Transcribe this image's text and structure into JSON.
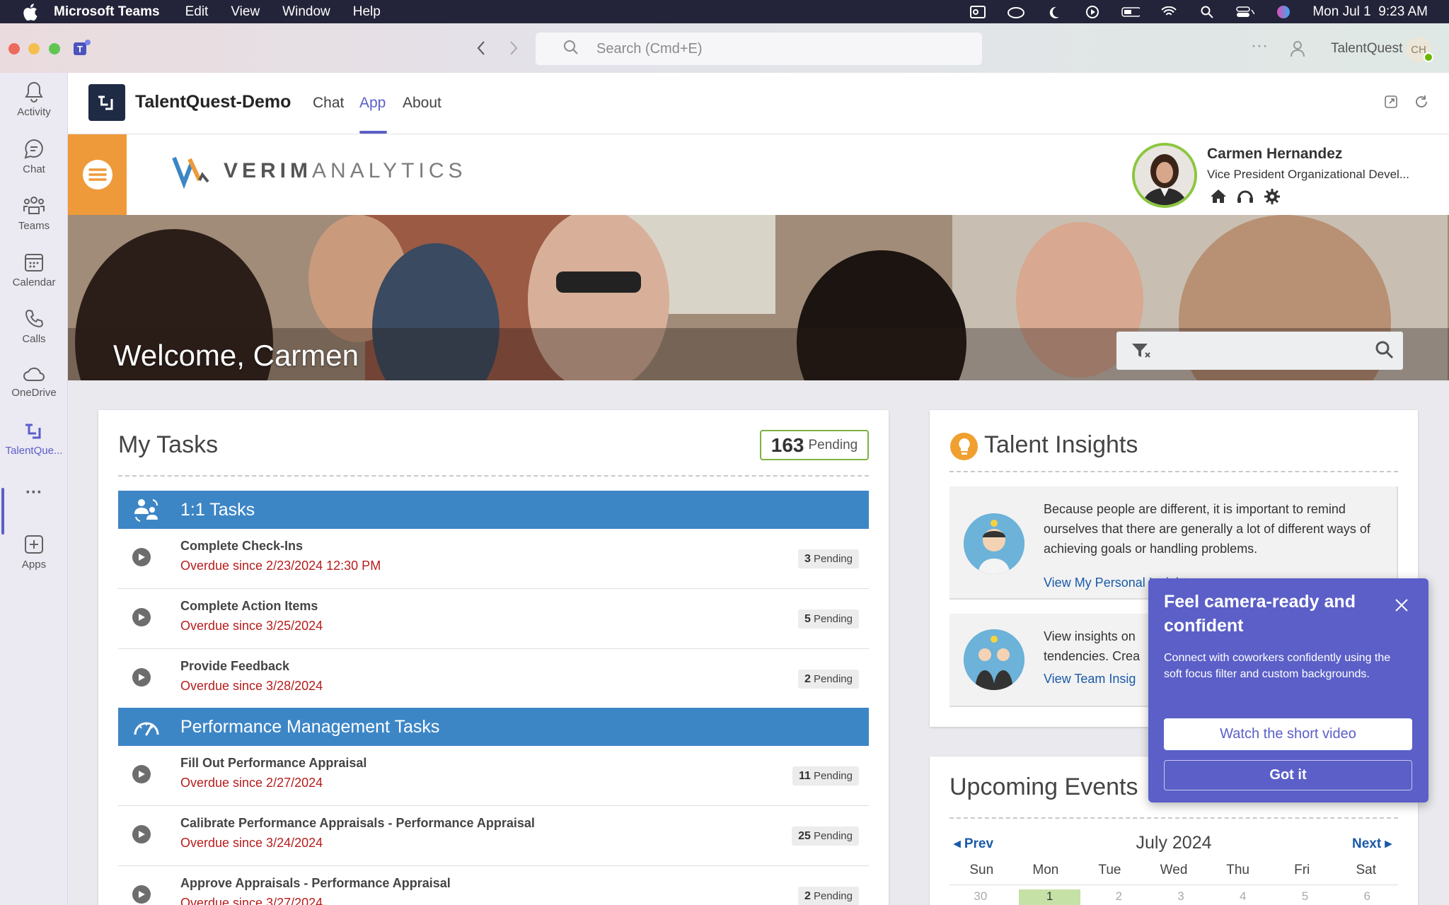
{
  "menubar": {
    "app": "Microsoft Teams",
    "items": [
      "Edit",
      "View",
      "Window",
      "Help"
    ],
    "datetime": "Mon Jul 1  9:23 AM"
  },
  "titlebar": {
    "search_placeholder": "Search (Cmd+E)",
    "more": "···",
    "org": "TalentQuest",
    "initials": "CH"
  },
  "rail": {
    "items": [
      {
        "label": "Activity",
        "icon": "bell-icon"
      },
      {
        "label": "Chat",
        "icon": "chat-icon"
      },
      {
        "label": "Teams",
        "icon": "teams-icon"
      },
      {
        "label": "Calendar",
        "icon": "calendar-icon"
      },
      {
        "label": "Calls",
        "icon": "phone-icon"
      },
      {
        "label": "OneDrive",
        "icon": "cloud-icon"
      },
      {
        "label": "TalentQue...",
        "icon": "talentquest-icon"
      },
      {
        "label": "···",
        "icon": "more-icon"
      },
      {
        "label": "Apps",
        "icon": "plus-icon"
      }
    ]
  },
  "appheader": {
    "name": "TalentQuest-Demo",
    "tabs": [
      "Chat",
      "App",
      "About"
    ],
    "active_tab": "App"
  },
  "brand": {
    "logo_strong": "VERIM",
    "logo_light": "ANALYTICS"
  },
  "profile": {
    "name": "Carmen Hernandez",
    "title": "Vice President Organizational Devel..."
  },
  "banner": {
    "welcome": "Welcome, Carmen"
  },
  "tasks": {
    "title": "My Tasks",
    "pending_count": "163",
    "pending_label": "Pending",
    "sections": [
      {
        "title": "1:1 Tasks",
        "rows": [
          {
            "name": "Complete Check-Ins",
            "overdue": "Overdue since 2/23/2024 12:30 PM",
            "count": "3",
            "label": "Pending"
          },
          {
            "name": "Complete Action Items",
            "overdue": "Overdue since 3/25/2024",
            "count": "5",
            "label": "Pending"
          },
          {
            "name": "Provide Feedback",
            "overdue": "Overdue since 3/28/2024",
            "count": "2",
            "label": "Pending"
          }
        ]
      },
      {
        "title": "Performance Management Tasks",
        "rows": [
          {
            "name": "Fill Out Performance Appraisal",
            "overdue": "Overdue since 2/27/2024",
            "count": "11",
            "label": "Pending"
          },
          {
            "name": "Calibrate Performance Appraisals - Performance Appraisal",
            "overdue": "Overdue since 3/24/2024",
            "count": "25",
            "label": "Pending"
          },
          {
            "name": "Approve Appraisals - Performance Appraisal",
            "overdue": "Overdue since 3/27/2024",
            "count": "2",
            "label": "Pending"
          }
        ]
      }
    ]
  },
  "insights": {
    "title": "Talent Insights",
    "cards": [
      {
        "text": "Because people are different, it is important to remind ourselves that there are generally a lot of different ways of achieving goals or handling problems.",
        "link": "View My Personal Insights"
      },
      {
        "text": "View insights on tendencies. Crea",
        "link": "View Team Insig"
      }
    ]
  },
  "events": {
    "title": "Upcoming Events",
    "prev": "Prev",
    "next": "Next",
    "month": "July 2024",
    "days": [
      "Sun",
      "Mon",
      "Tue",
      "Wed",
      "Thu",
      "Fri",
      "Sat"
    ],
    "dates": [
      "30",
      "1",
      "2",
      "3",
      "4",
      "5",
      "6"
    ]
  },
  "popup": {
    "title": "Feel camera-ready and confident",
    "body": "Connect with coworkers confidently using the soft focus filter and custom backgrounds.",
    "primary": "Watch the short video",
    "secondary": "Got it"
  },
  "colors": {
    "teams_purple": "#5b5fc7",
    "section_blue": "#3d86c6",
    "overdue_red": "#b71c1c",
    "accent_orange": "#ef9a3a",
    "pending_green": "#7cb342"
  }
}
